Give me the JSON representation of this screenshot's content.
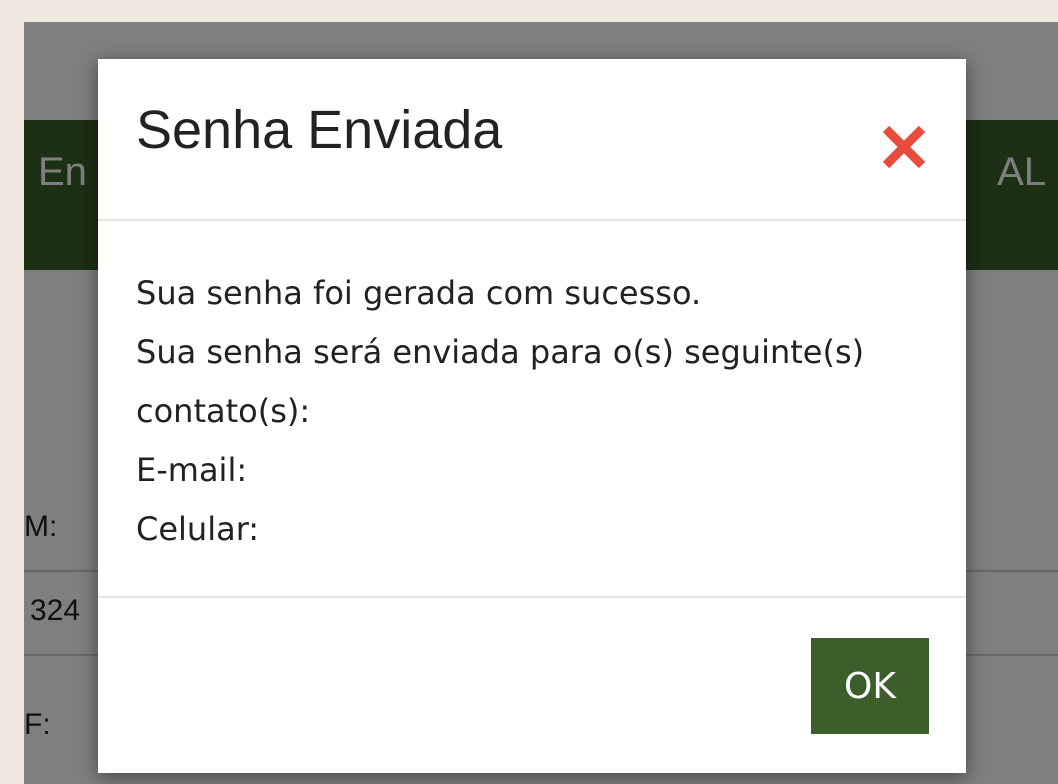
{
  "background_page": {
    "header_left_text": "En",
    "header_right_text": "AL",
    "label_1": "M:",
    "value_1": "324",
    "label_2": "F:"
  },
  "modal": {
    "title": "Senha Enviada",
    "close_icon": "close-x-icon",
    "body_lines": [
      "Sua senha foi gerada com sucesso.",
      "Sua senha será enviada para o(s) seguinte(s)",
      "contato(s):",
      "E-mail:",
      "Celular:"
    ],
    "ok_label": "OK"
  },
  "colors": {
    "brand_green": "#3b5e2b",
    "close_red": "#e74c3c",
    "outer_frame": "#efe8df"
  }
}
